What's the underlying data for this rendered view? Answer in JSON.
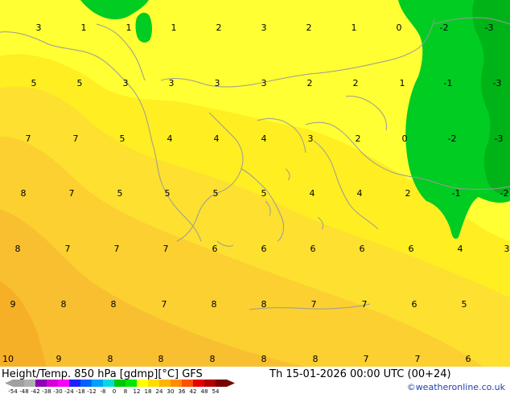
{
  "map": {
    "footer_left": "Height/Temp. 850 hPa [gdmp][°C] GFS",
    "footer_datetime": "Th 15-01-2026 00:00 UTC (00+24)",
    "credit": "©weatheronline.co.uk",
    "scale_labels": [
      "-54",
      "-48",
      "-42",
      "-38",
      "-30",
      "-24",
      "-18",
      "-12",
      "-8",
      "0",
      "8",
      "12",
      "18",
      "24",
      "30",
      "36",
      "42",
      "48",
      "54"
    ],
    "scale_colors": [
      "#a0a0a0",
      "#b0b0b0",
      "#8c00b4",
      "#d200d2",
      "#fa00fa",
      "#1e1eff",
      "#0064ff",
      "#00a0ff",
      "#00dcdc",
      "#00c800",
      "#00e600",
      "#ffff00",
      "#ffdc00",
      "#ffb400",
      "#ff8c00",
      "#ff5000",
      "#e60000",
      "#b40000",
      "#780000"
    ],
    "region_colors": {
      "cold_green": "#00cc22",
      "deep_green": "#00b418",
      "bright_yellow": "#ffff33",
      "yellow": "#ffee22",
      "gold": "#fde030",
      "light_orange": "#fbd030",
      "orange": "#f8c030",
      "dark_orange": "#f6b028",
      "coast": "#9a9a9a"
    },
    "temperature_labels": [
      {
        "v": "3"
      },
      {
        "v": "1"
      },
      {
        "v": "1"
      },
      {
        "v": "1"
      },
      {
        "v": "2"
      },
      {
        "v": "3"
      },
      {
        "v": "2"
      },
      {
        "v": "1"
      },
      {
        "v": "0"
      },
      {
        "v": "-2"
      },
      {
        "v": "-3"
      },
      {
        "v": "5"
      },
      {
        "v": "5"
      },
      {
        "v": "3"
      },
      {
        "v": "3"
      },
      {
        "v": "3"
      },
      {
        "v": "3"
      },
      {
        "v": "2"
      },
      {
        "v": "2"
      },
      {
        "v": "1"
      },
      {
        "v": "-1"
      },
      {
        "v": "-3"
      },
      {
        "v": "7"
      },
      {
        "v": "7"
      },
      {
        "v": "5"
      },
      {
        "v": "4"
      },
      {
        "v": "4"
      },
      {
        "v": "4"
      },
      {
        "v": "3"
      },
      {
        "v": "2"
      },
      {
        "v": "0"
      },
      {
        "v": "-2"
      },
      {
        "v": "-3"
      },
      {
        "v": "8"
      },
      {
        "v": "7"
      },
      {
        "v": "5"
      },
      {
        "v": "5"
      },
      {
        "v": "5"
      },
      {
        "v": "5"
      },
      {
        "v": "4"
      },
      {
        "v": "4"
      },
      {
        "v": "2"
      },
      {
        "v": "-1"
      },
      {
        "v": "-2"
      },
      {
        "v": "8"
      },
      {
        "v": "7"
      },
      {
        "v": "7"
      },
      {
        "v": "7"
      },
      {
        "v": "6"
      },
      {
        "v": "6"
      },
      {
        "v": "6"
      },
      {
        "v": "6"
      },
      {
        "v": "6"
      },
      {
        "v": "4"
      },
      {
        "v": "3"
      },
      {
        "v": "9"
      },
      {
        "v": "8"
      },
      {
        "v": "8"
      },
      {
        "v": "7"
      },
      {
        "v": "8"
      },
      {
        "v": "8"
      },
      {
        "v": "7"
      },
      {
        "v": "7"
      },
      {
        "v": "6"
      },
      {
        "v": "5"
      },
      {
        "v": "10"
      },
      {
        "v": "9"
      },
      {
        "v": "8"
      },
      {
        "v": "8"
      },
      {
        "v": "8"
      },
      {
        "v": "8"
      },
      {
        "v": "8"
      },
      {
        "v": "7"
      },
      {
        "v": "7"
      },
      {
        "v": "6"
      }
    ]
  }
}
